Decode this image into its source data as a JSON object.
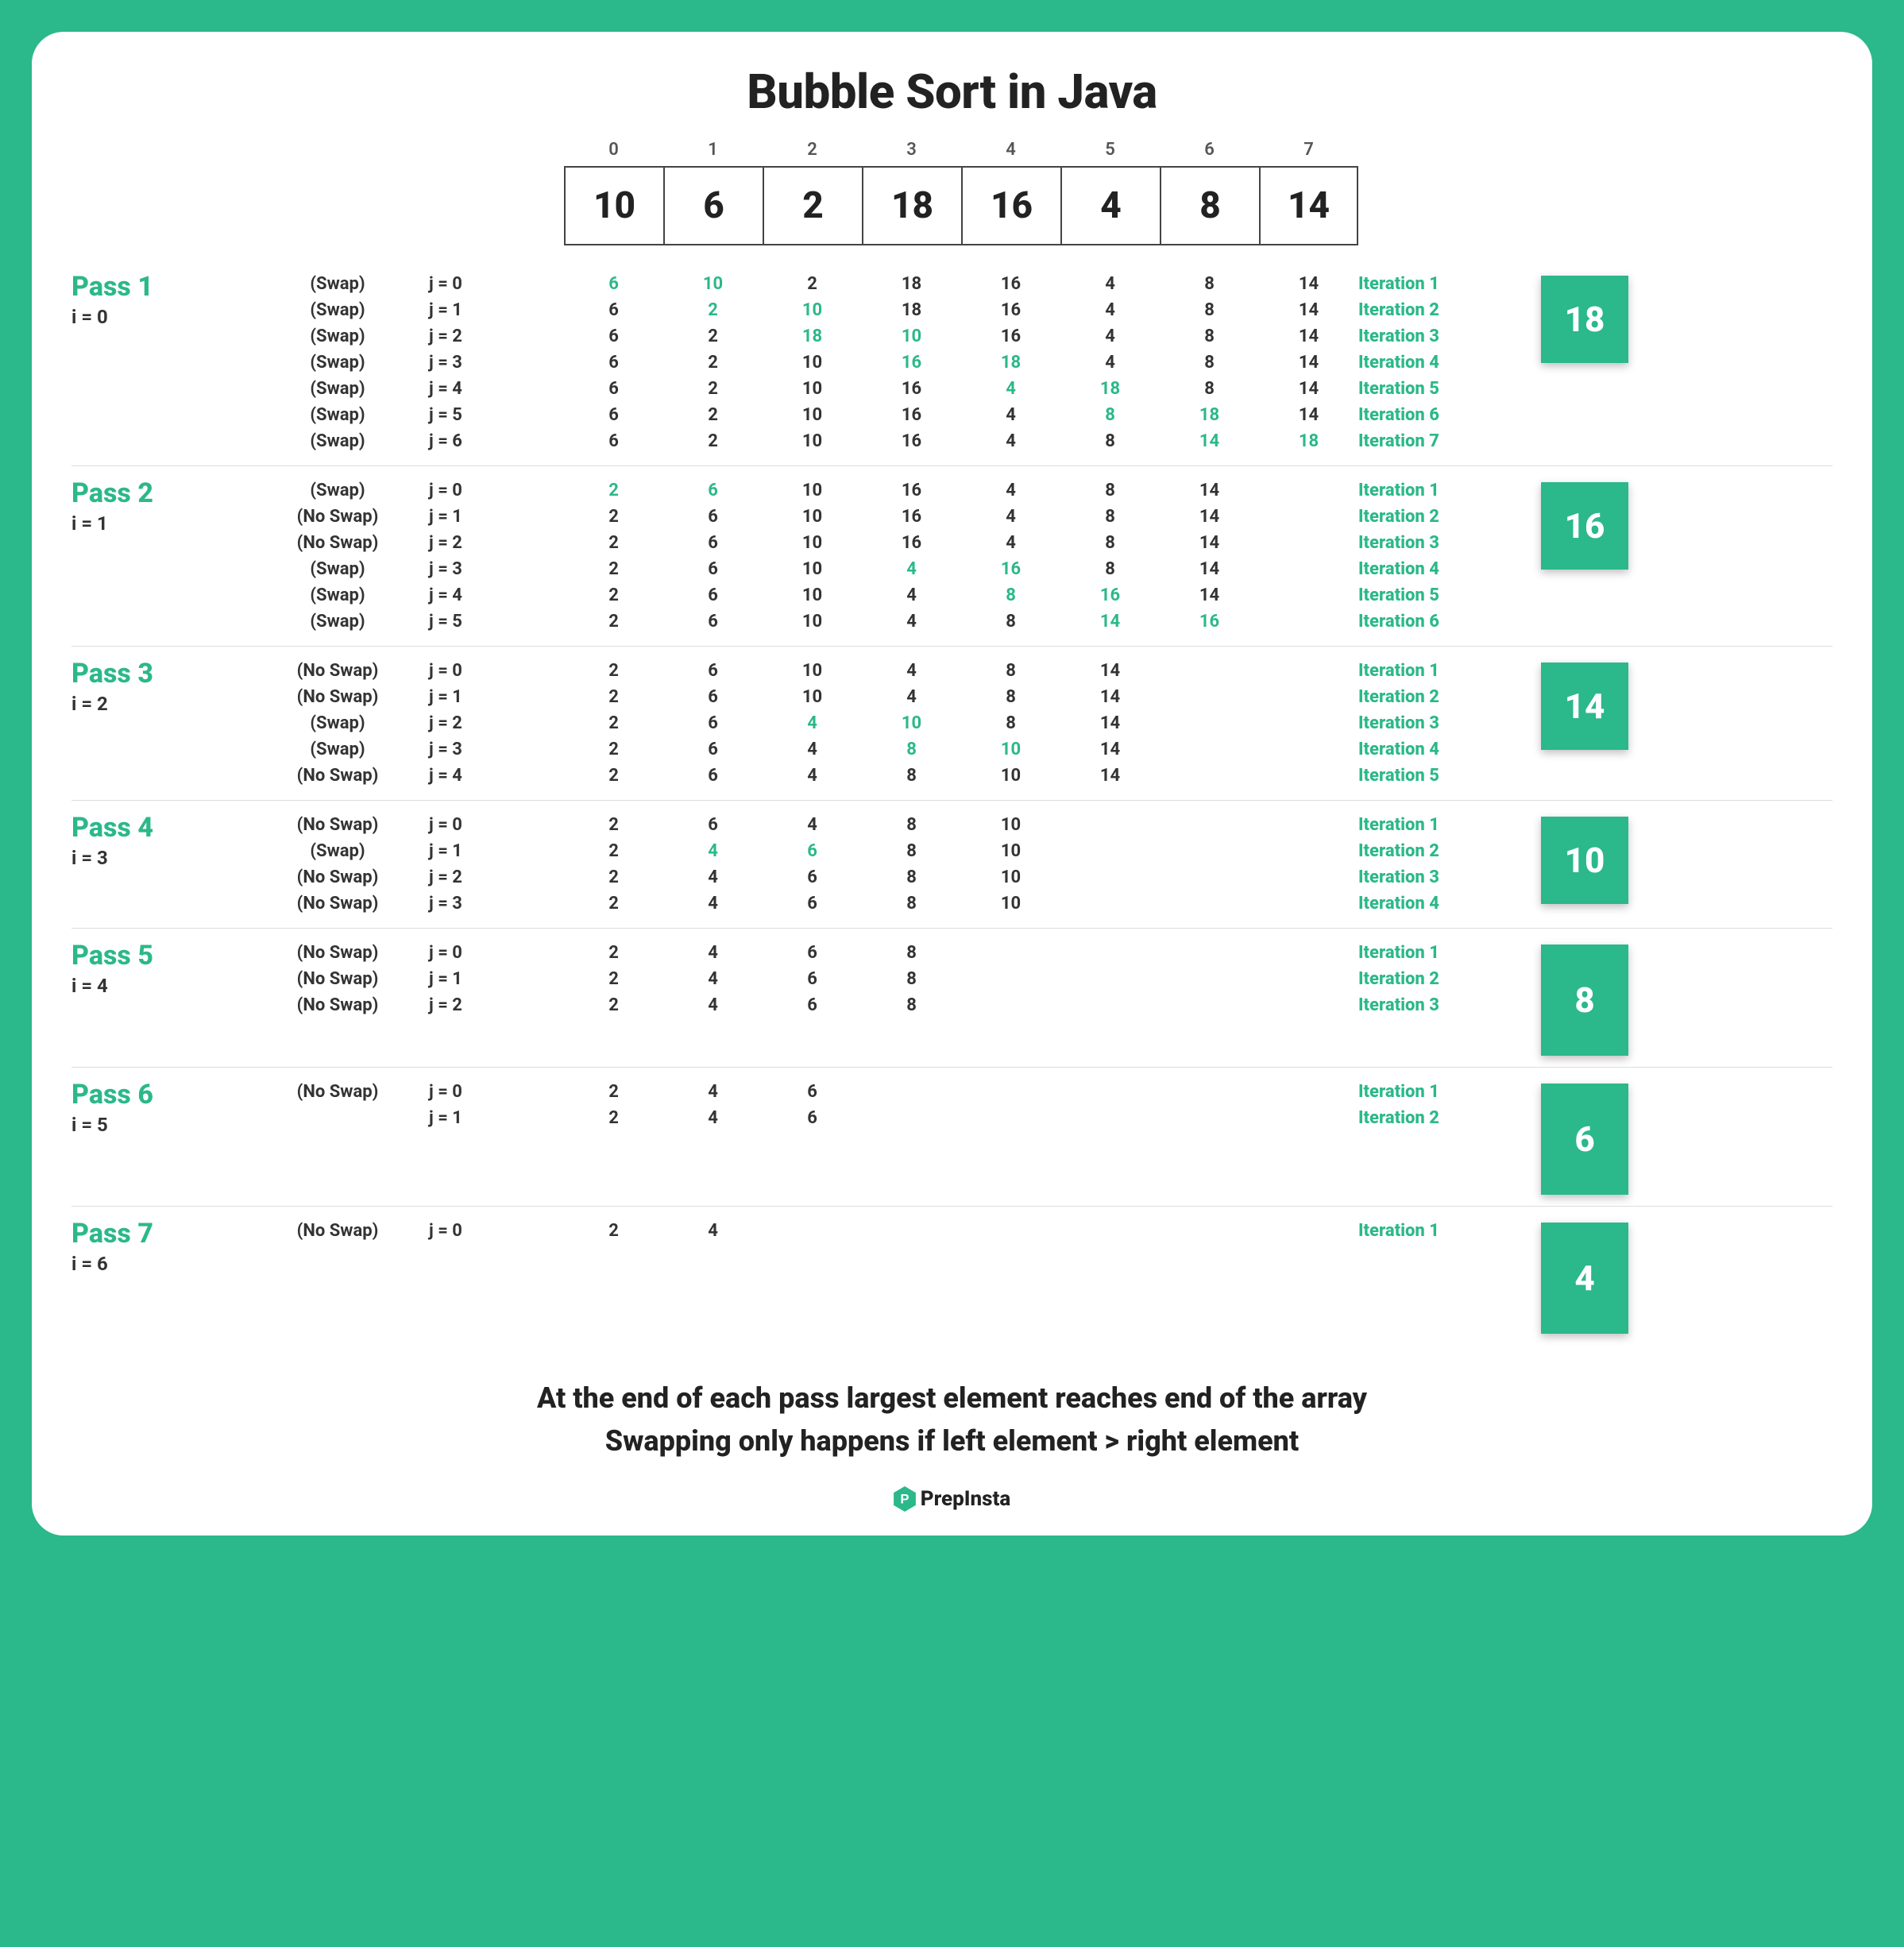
{
  "title": "Bubble Sort in Java",
  "indices": [
    "0",
    "1",
    "2",
    "3",
    "4",
    "5",
    "6",
    "7"
  ],
  "initial": [
    "10",
    "6",
    "2",
    "18",
    "16",
    "4",
    "8",
    "14"
  ],
  "passes": [
    {
      "name": "Pass 1",
      "sub": "i = 0",
      "result": "18",
      "iters": [
        {
          "swap": "(Swap)",
          "j": "j = 0",
          "vals": [
            "6",
            "10",
            "2",
            "18",
            "16",
            "4",
            "8",
            "14"
          ],
          "hl": [
            0,
            1
          ],
          "label": "Iteration 1"
        },
        {
          "swap": "(Swap)",
          "j": "j = 1",
          "vals": [
            "6",
            "2",
            "10",
            "18",
            "16",
            "4",
            "8",
            "14"
          ],
          "hl": [
            1,
            2
          ],
          "label": "Iteration 2"
        },
        {
          "swap": "(Swap)",
          "j": "j = 2",
          "vals": [
            "6",
            "2",
            "18",
            "10",
            "16",
            "4",
            "8",
            "14"
          ],
          "hl": [
            2,
            3
          ],
          "label": "Iteration 3"
        },
        {
          "swap": "(Swap)",
          "j": "j = 3",
          "vals": [
            "6",
            "2",
            "10",
            "16",
            "18",
            "4",
            "8",
            "14"
          ],
          "hl": [
            3,
            4
          ],
          "label": "Iteration 4"
        },
        {
          "swap": "(Swap)",
          "j": "j = 4",
          "vals": [
            "6",
            "2",
            "10",
            "16",
            "4",
            "18",
            "8",
            "14"
          ],
          "hl": [
            4,
            5
          ],
          "label": "Iteration 5"
        },
        {
          "swap": "(Swap)",
          "j": "j = 5",
          "vals": [
            "6",
            "2",
            "10",
            "16",
            "4",
            "8",
            "18",
            "14"
          ],
          "hl": [
            5,
            6
          ],
          "label": "Iteration 6"
        },
        {
          "swap": "(Swap)",
          "j": "j = 6",
          "vals": [
            "6",
            "2",
            "10",
            "16",
            "4",
            "8",
            "14",
            "18"
          ],
          "hl": [
            6,
            7
          ],
          "label": "Iteration 7"
        }
      ]
    },
    {
      "name": "Pass 2",
      "sub": "i = 1",
      "result": "16",
      "iters": [
        {
          "swap": "(Swap)",
          "j": "j = 0",
          "vals": [
            "2",
            "6",
            "10",
            "16",
            "4",
            "8",
            "14"
          ],
          "hl": [
            0,
            1
          ],
          "label": "Iteration 1"
        },
        {
          "swap": "(No Swap)",
          "j": "j = 1",
          "vals": [
            "2",
            "6",
            "10",
            "16",
            "4",
            "8",
            "14"
          ],
          "hl": [],
          "label": "Iteration 2"
        },
        {
          "swap": "(No Swap)",
          "j": "j = 2",
          "vals": [
            "2",
            "6",
            "10",
            "16",
            "4",
            "8",
            "14"
          ],
          "hl": [],
          "label": "Iteration 3"
        },
        {
          "swap": "(Swap)",
          "j": "j = 3",
          "vals": [
            "2",
            "6",
            "10",
            "4",
            "16",
            "8",
            "14"
          ],
          "hl": [
            3,
            4
          ],
          "label": "Iteration 4"
        },
        {
          "swap": "(Swap)",
          "j": "j = 4",
          "vals": [
            "2",
            "6",
            "10",
            "4",
            "8",
            "16",
            "14"
          ],
          "hl": [
            4,
            5
          ],
          "label": "Iteration 5"
        },
        {
          "swap": "(Swap)",
          "j": "j = 5",
          "vals": [
            "2",
            "6",
            "10",
            "4",
            "8",
            "14",
            "16"
          ],
          "hl": [
            5,
            6
          ],
          "label": "Iteration 6"
        }
      ]
    },
    {
      "name": "Pass 3",
      "sub": "i = 2",
      "result": "14",
      "iters": [
        {
          "swap": "(No Swap)",
          "j": "j = 0",
          "vals": [
            "2",
            "6",
            "10",
            "4",
            "8",
            "14"
          ],
          "hl": [],
          "label": "Iteration 1"
        },
        {
          "swap": "(No Swap)",
          "j": "j = 1",
          "vals": [
            "2",
            "6",
            "10",
            "4",
            "8",
            "14"
          ],
          "hl": [],
          "label": "Iteration 2"
        },
        {
          "swap": "(Swap)",
          "j": "j = 2",
          "vals": [
            "2",
            "6",
            "4",
            "10",
            "8",
            "14"
          ],
          "hl": [
            2,
            3
          ],
          "label": "Iteration 3"
        },
        {
          "swap": "(Swap)",
          "j": "j = 3",
          "vals": [
            "2",
            "6",
            "4",
            "8",
            "10",
            "14"
          ],
          "hl": [
            3,
            4
          ],
          "label": "Iteration 4"
        },
        {
          "swap": "(No Swap)",
          "j": "j = 4",
          "vals": [
            "2",
            "6",
            "4",
            "8",
            "10",
            "14"
          ],
          "hl": [],
          "label": "Iteration 5"
        }
      ]
    },
    {
      "name": "Pass 4",
      "sub": "i = 3",
      "result": "10",
      "iters": [
        {
          "swap": "(No Swap)",
          "j": "j = 0",
          "vals": [
            "2",
            "6",
            "4",
            "8",
            "10"
          ],
          "hl": [],
          "label": "Iteration 1"
        },
        {
          "swap": "(Swap)",
          "j": "j = 1",
          "vals": [
            "2",
            "4",
            "6",
            "8",
            "10"
          ],
          "hl": [
            1,
            2
          ],
          "label": "Iteration 2"
        },
        {
          "swap": "(No Swap)",
          "j": "j = 2",
          "vals": [
            "2",
            "4",
            "6",
            "8",
            "10"
          ],
          "hl": [],
          "label": "Iteration 3"
        },
        {
          "swap": "(No Swap)",
          "j": "j = 3",
          "vals": [
            "2",
            "4",
            "6",
            "8",
            "10"
          ],
          "hl": [],
          "label": "Iteration 4"
        }
      ]
    },
    {
      "name": "Pass 5",
      "sub": "i = 4",
      "result": "8",
      "tall": true,
      "iters": [
        {
          "swap": "(No Swap)",
          "j": "j = 0",
          "vals": [
            "2",
            "4",
            "6",
            "8"
          ],
          "hl": [],
          "label": "Iteration 1"
        },
        {
          "swap": "(No Swap)",
          "j": "j = 1",
          "vals": [
            "2",
            "4",
            "6",
            "8"
          ],
          "hl": [],
          "label": "Iteration 2"
        },
        {
          "swap": "(No Swap)",
          "j": "j = 2",
          "vals": [
            "2",
            "4",
            "6",
            "8"
          ],
          "hl": [],
          "label": "Iteration 3"
        }
      ]
    },
    {
      "name": "Pass 6",
      "sub": "i = 5",
      "result": "6",
      "tall": true,
      "iters": [
        {
          "swap": "(No Swap)",
          "j": "j = 0",
          "vals": [
            "2",
            "4",
            "6"
          ],
          "hl": [],
          "label": "Iteration 1"
        },
        {
          "swap": "",
          "j": "j = 1",
          "vals": [
            "2",
            "4",
            "6"
          ],
          "hl": [],
          "label": "Iteration 2"
        }
      ]
    },
    {
      "name": "Pass 7",
      "sub": "i = 6",
      "result": "4",
      "tall": true,
      "iters": [
        {
          "swap": "(No Swap)",
          "j": "j = 0",
          "vals": [
            "2",
            "4"
          ],
          "hl": [],
          "label": "Iteration 1"
        }
      ]
    }
  ],
  "footer1": "At the end of each pass largest element reaches end of the array",
  "footer2": "Swapping only happens if left element > right element",
  "brand": "PrepInsta"
}
